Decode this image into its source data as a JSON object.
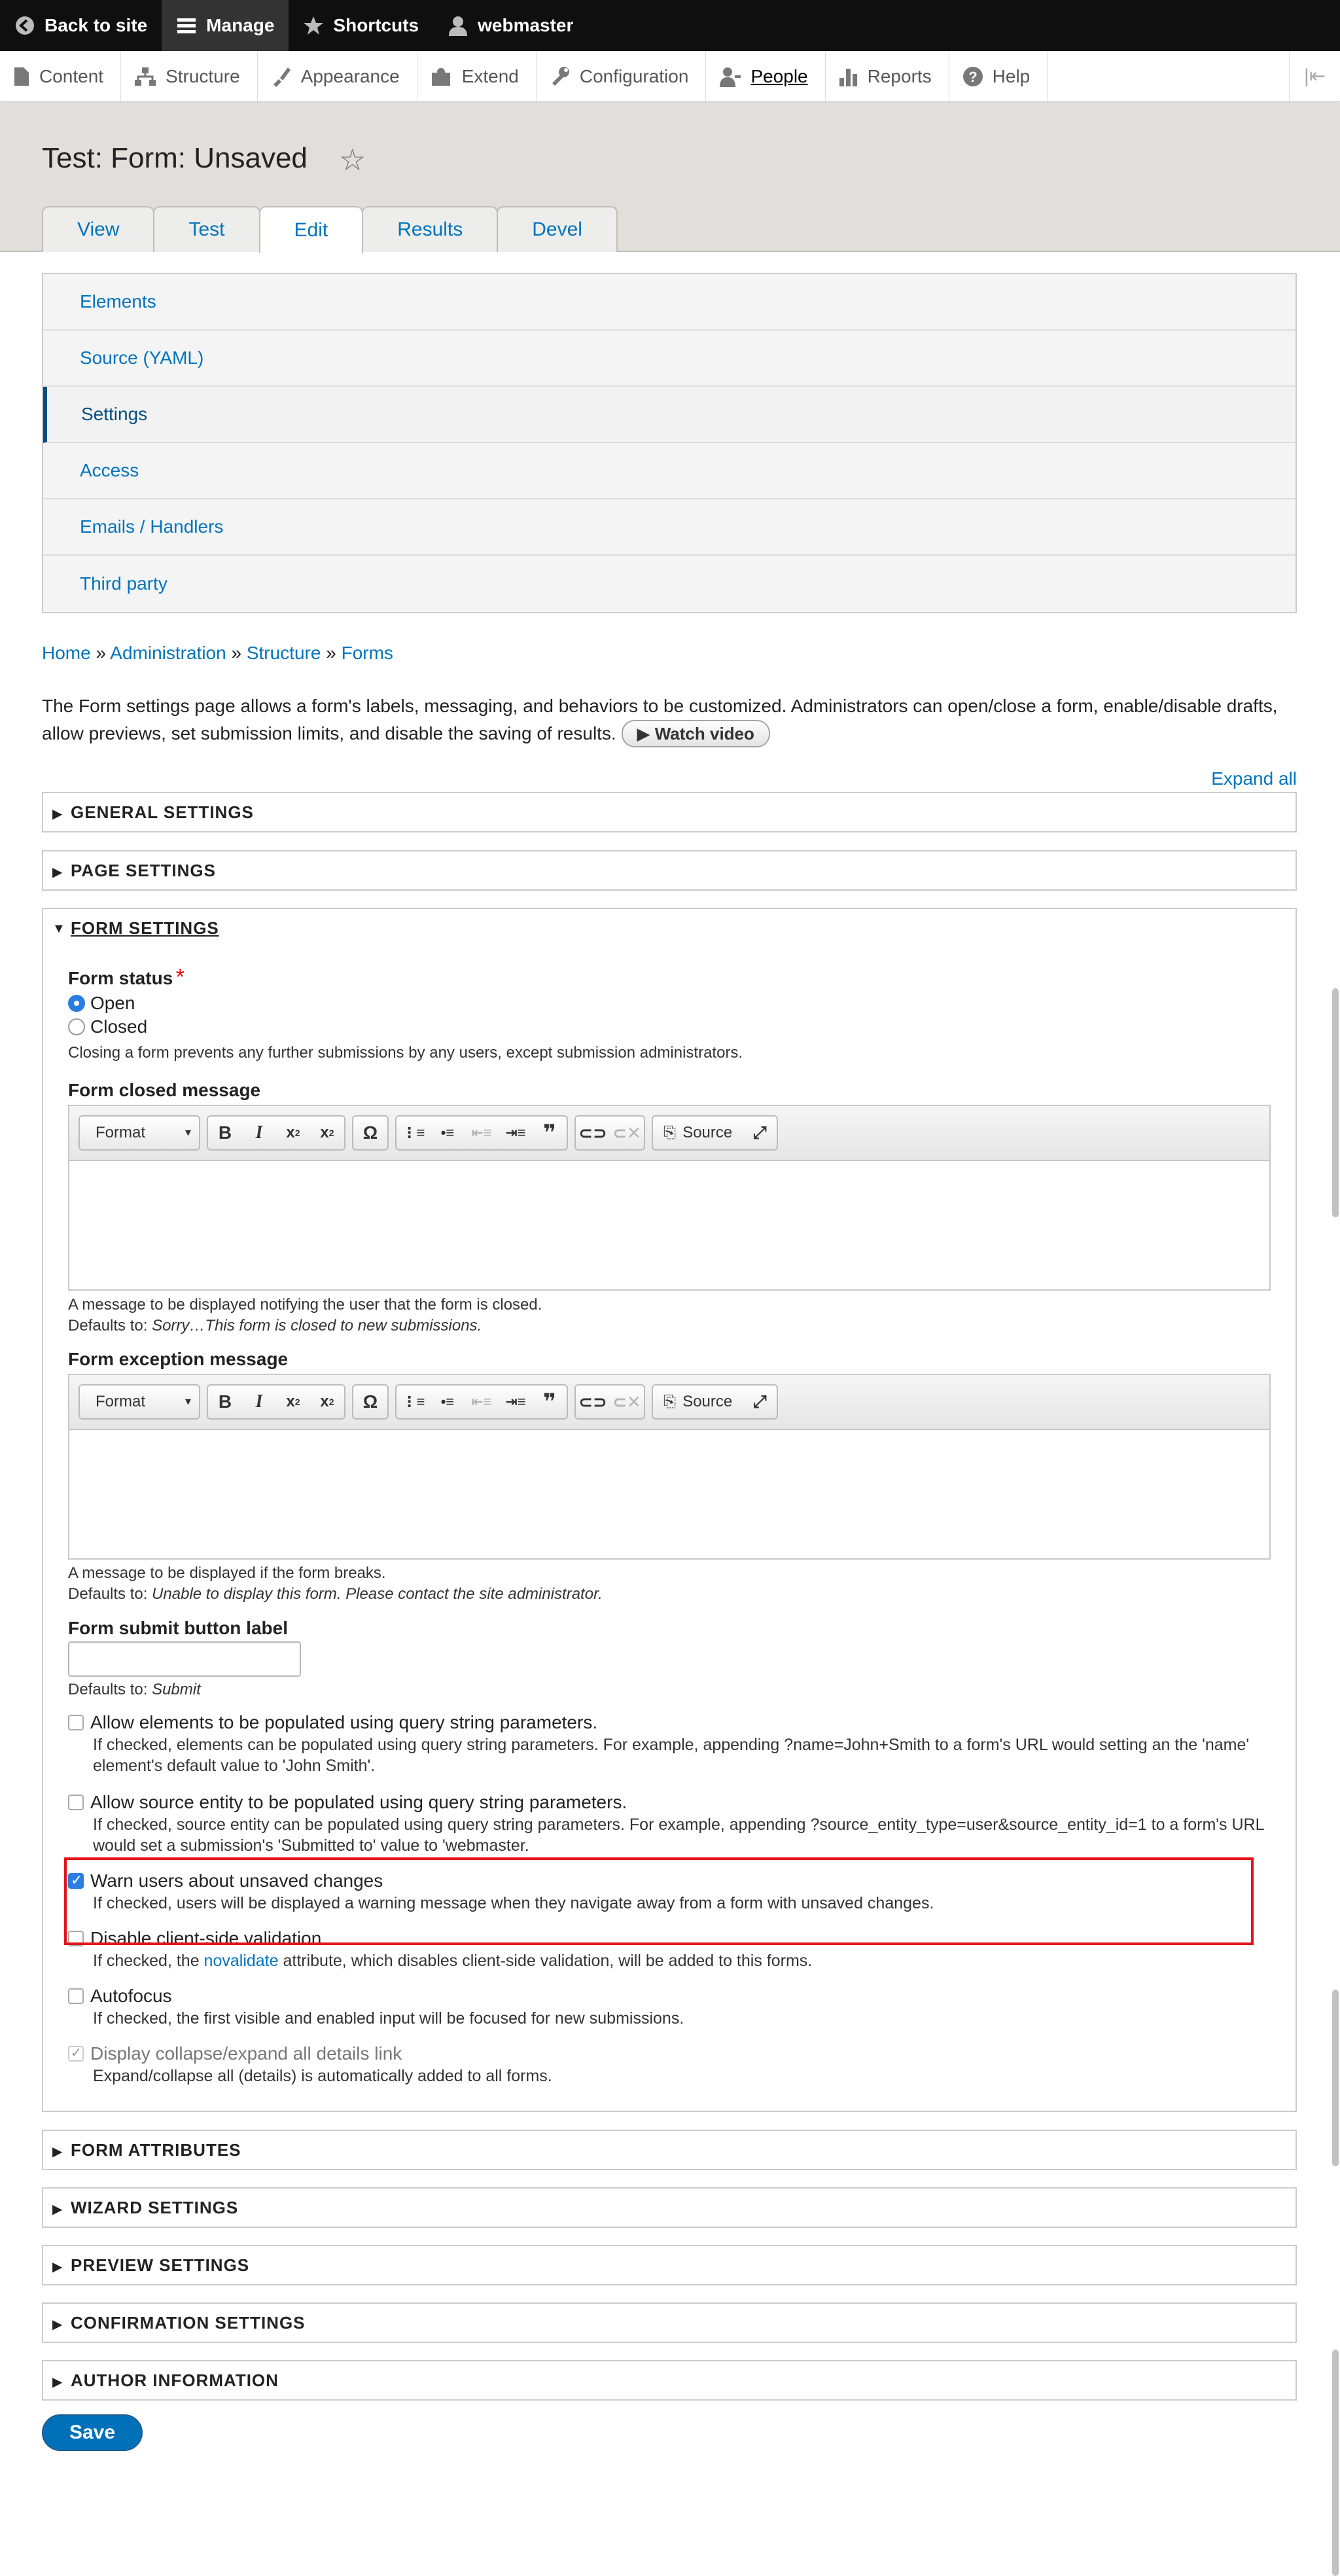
{
  "toolbar": {
    "back": "Back to site",
    "manage": "Manage",
    "shortcuts": "Shortcuts",
    "user": "webmaster"
  },
  "tray": {
    "items": [
      "Content",
      "Structure",
      "Appearance",
      "Extend",
      "Configuration",
      "People",
      "Reports",
      "Help"
    ]
  },
  "header": {
    "title": "Test: Form: Unsaved",
    "tabs": [
      "View",
      "Test",
      "Edit",
      "Results",
      "Devel"
    ]
  },
  "vtabs": [
    "Elements",
    "Source (YAML)",
    "Settings",
    "Access",
    "Emails / Handlers",
    "Third party"
  ],
  "breadcrumb": [
    "Home",
    "Administration",
    "Structure",
    "Forms"
  ],
  "breadcrumb_sep": "»",
  "description": "The Form settings page allows a form's labels, messaging, and behaviors to be customized. Administrators can open/close a form, enable/disable drafts, allow previews, set submission limits, and disable the saving of results.",
  "watch_video": "▶ Watch video",
  "expand_all": "Expand all",
  "sections": {
    "general": "GENERAL SETTINGS",
    "page": "PAGE SETTINGS",
    "form": "FORM SETTINGS",
    "attributes": "FORM ATTRIBUTES",
    "wizard": "WIZARD SETTINGS",
    "preview": "PREVIEW SETTINGS",
    "confirmation": "CONFIRMATION SETTINGS",
    "author": "AUTHOR INFORMATION"
  },
  "form_status": {
    "label": "Form status",
    "required_mark": "*",
    "open": "Open",
    "closed": "Closed",
    "help": "Closing a form prevents any further submissions by any users, except submission administrators."
  },
  "editor": {
    "format": "Format",
    "source": "Source"
  },
  "closed_message": {
    "label": "Form closed message",
    "help": "A message to be displayed notifying the user that the form is closed.",
    "defaults_prefix": "Defaults to: ",
    "default": "Sorry…This form is closed to new submissions."
  },
  "exception_message": {
    "label": "Form exception message",
    "help": "A message to be displayed if the form breaks.",
    "defaults_prefix": "Defaults to: ",
    "default": "Unable to display this form. Please contact the site administrator."
  },
  "submit_label": {
    "label": "Form submit button label",
    "defaults_prefix": "Defaults to: ",
    "default": "Submit"
  },
  "checkboxes": {
    "query": {
      "label": "Allow elements to be populated using query string parameters.",
      "desc": "If checked, elements can be populated using query string parameters. For example, appending ?name=John+Smith to a form's URL would setting an the 'name' element's default value to 'John Smith'."
    },
    "source_entity": {
      "label": "Allow source entity to be populated using query string parameters.",
      "desc": "If checked, source entity can be populated using query string parameters. For example, appending ?source_entity_type=user&source_entity_id=1 to a form's URL would set a submission's 'Submitted to' value to 'webmaster."
    },
    "unsaved": {
      "label": "Warn users about unsaved changes",
      "desc": "If checked, users will be displayed a warning message when they navigate away from a form with unsaved changes."
    },
    "novalidate": {
      "label": "Disable client-side validation",
      "desc_pre": "If checked, the ",
      "desc_link": "novalidate",
      "desc_post": " attribute, which disables client-side validation, will be added to this forms."
    },
    "autofocus": {
      "label": "Autofocus",
      "desc": "If checked, the first visible and enabled input will be focused for new submissions."
    },
    "collapse": {
      "label": "Display collapse/expand all details link",
      "desc": "Expand/collapse all (details) is automatically added to all forms."
    }
  },
  "save": "Save"
}
